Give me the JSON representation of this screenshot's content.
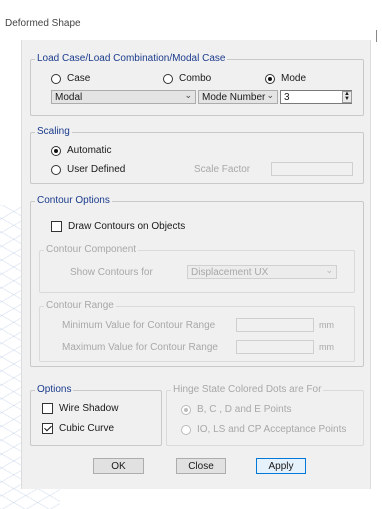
{
  "window": {
    "title": "Deformed Shape"
  },
  "load_case": {
    "legend": "Load Case/Load Combination/Modal Case",
    "options": [
      {
        "label": "Case",
        "checked": false
      },
      {
        "label": "Combo",
        "checked": false
      },
      {
        "label": "Mode",
        "checked": true
      }
    ],
    "case_select": "Modal",
    "mode_type_select": "Mode Number",
    "mode_number": "3"
  },
  "scaling": {
    "legend": "Scaling",
    "automatic_label": "Automatic",
    "user_defined_label": "User Defined",
    "scale_factor_label": "Scale Factor",
    "scale_factor_value": ""
  },
  "contour_options": {
    "legend": "Contour Options",
    "draw_contours_label": "Draw Contours on Objects",
    "component": {
      "legend": "Contour Component",
      "show_for_label": "Show Contours for",
      "show_for_value": "Displacement UX"
    },
    "range": {
      "legend": "Contour Range",
      "min_label": "Minimum Value for Contour Range",
      "max_label": "Maximum Value for Contour Range",
      "min_value": "",
      "max_value": "",
      "unit": "mm"
    }
  },
  "options": {
    "legend": "Options",
    "wire_shadow_label": "Wire Shadow",
    "cubic_curve_label": "Cubic Curve"
  },
  "hinge": {
    "legend": "Hinge State Colored Dots are For",
    "bcde_label": "B, C , D and E Points",
    "io_label": "IO, LS and CP Acceptance Points"
  },
  "buttons": {
    "ok": "OK",
    "close": "Close",
    "apply": "Apply"
  }
}
